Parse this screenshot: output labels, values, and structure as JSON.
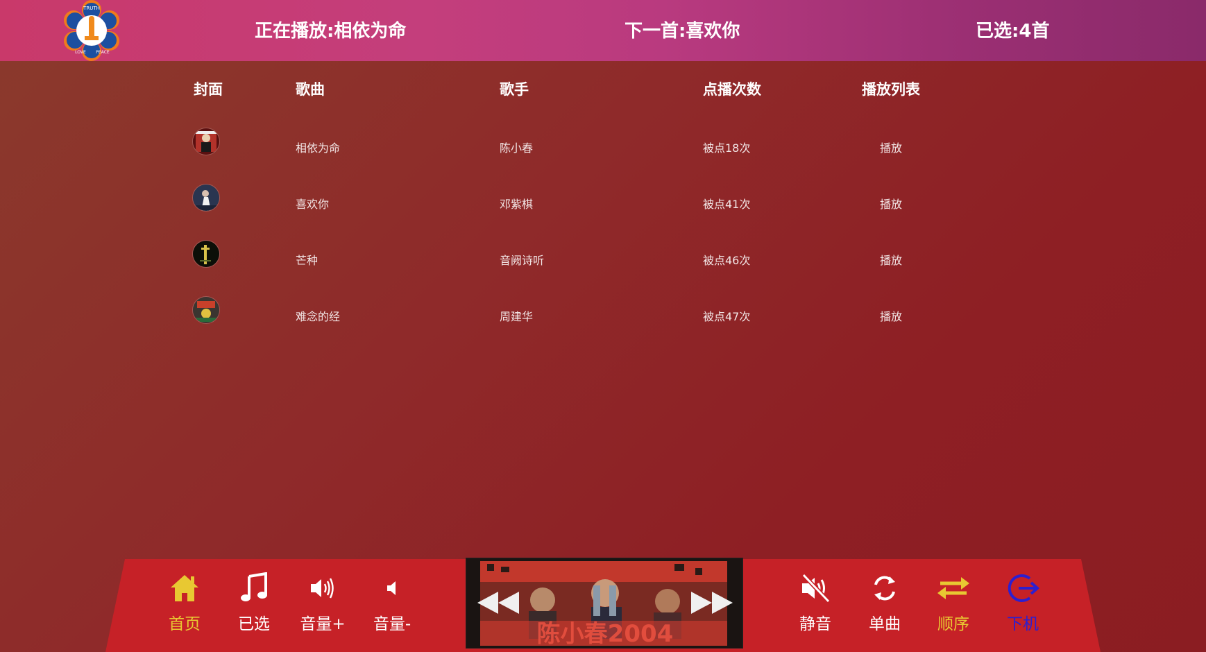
{
  "header": {
    "now_playing": "正在播放:相依为命",
    "next_song": "下一首:喜欢你",
    "selected_count": "已选:4首",
    "logo_words": [
      "TRUTH",
      "LOVE",
      "PEACE"
    ]
  },
  "table": {
    "columns": [
      "封面",
      "歌曲",
      "歌手",
      "点播次数",
      "播放列表"
    ],
    "rows": [
      {
        "song": "相依为命",
        "singer": "陈小春",
        "plays": "被点18次",
        "action": "播放"
      },
      {
        "song": "喜欢你",
        "singer": "邓紫棋",
        "plays": "被点41次",
        "action": "播放"
      },
      {
        "song": "芒种",
        "singer": "音阙诗听",
        "plays": "被点46次",
        "action": "播放"
      },
      {
        "song": "难念的经",
        "singer": "周建华",
        "plays": "被点47次",
        "action": "播放"
      }
    ]
  },
  "controls": {
    "home": {
      "label": "首页",
      "icon": "home-icon",
      "color": "#e8c832"
    },
    "selected": {
      "label": "已选",
      "icon": "music-note-icon",
      "color": "#ffffff"
    },
    "volume_up": {
      "label": "音量+",
      "icon": "volume-up-icon",
      "color": "#ffffff"
    },
    "volume_down": {
      "label": "音量-",
      "icon": "volume-down-icon",
      "color": "#ffffff"
    },
    "mute": {
      "label": "静音",
      "icon": "mute-icon",
      "color": "#ffffff"
    },
    "single": {
      "label": "单曲",
      "icon": "repeat-icon",
      "color": "#ffffff"
    },
    "order": {
      "label": "顺序",
      "icon": "shuffle-arrows-icon",
      "color": "#e8c832"
    },
    "shutdown": {
      "label": "下机",
      "icon": "logout-icon",
      "color": "#2c1fd0"
    }
  },
  "player": {
    "poster_text": "陈小春2004",
    "state": "playing"
  }
}
